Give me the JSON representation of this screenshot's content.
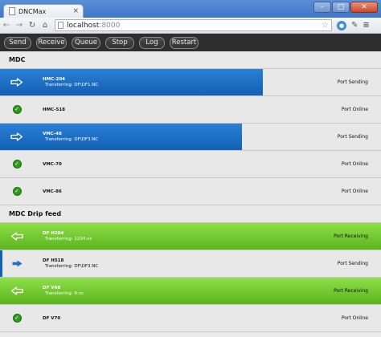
{
  "browser": {
    "tab_title": "DNCMax",
    "tab_close": "×",
    "url_host": "localhost",
    "url_port": ":8000",
    "window_controls": {
      "minimize": "–",
      "maximize": "□",
      "close": "✕"
    }
  },
  "commands": [
    "Send",
    "Receive",
    "Queue",
    "Stop",
    "Log",
    "Restart"
  ],
  "sections": {
    "mdc": {
      "title": "MDC",
      "rows": [
        {
          "name": "HMC-204",
          "sub": "Transferring: DF\\DF1.NC",
          "status": "Port Sending",
          "icon": "arrow-right-outline-icon",
          "progress": 0.69
        },
        {
          "name": "HMC-518",
          "sub": "",
          "status": "Port Online",
          "icon": "check-circle-icon"
        },
        {
          "name": "VMC-48",
          "sub": "Transferring: DF\\DF3.NC",
          "status": "Port Sending",
          "icon": "arrow-right-outline-icon",
          "progress": 0.635
        },
        {
          "name": "VMC-70",
          "sub": "",
          "status": "Port Online",
          "icon": "check-circle-icon"
        },
        {
          "name": "VMC-86",
          "sub": "",
          "status": "Port Online",
          "icon": "check-circle-icon"
        }
      ]
    },
    "drip": {
      "title": "MDC Drip feed",
      "rows": [
        {
          "name": "DF H204",
          "sub": "Transferring: 1234.nc",
          "status": "Port Receiving",
          "icon": "arrow-left-outline-icon",
          "progress": 1.0
        },
        {
          "name": "DF H518",
          "sub": "Transferring: DF\\DF3.NC",
          "status": "Port Sending",
          "icon": "arrow-right-solid-icon",
          "progress": 0
        },
        {
          "name": "DF V48",
          "sub": "Transferring: 9.nc",
          "status": "Port Receiving",
          "icon": "arrow-left-outline-icon",
          "progress": 1.0
        },
        {
          "name": "DF V70",
          "sub": "",
          "status": "Port Online",
          "icon": "check-circle-icon"
        }
      ]
    }
  },
  "colors": {
    "sending": "#1a6cc3",
    "receiving": "#6cc52a",
    "online": "#2e9a1a",
    "cmdbar": "#2e2e2e"
  }
}
